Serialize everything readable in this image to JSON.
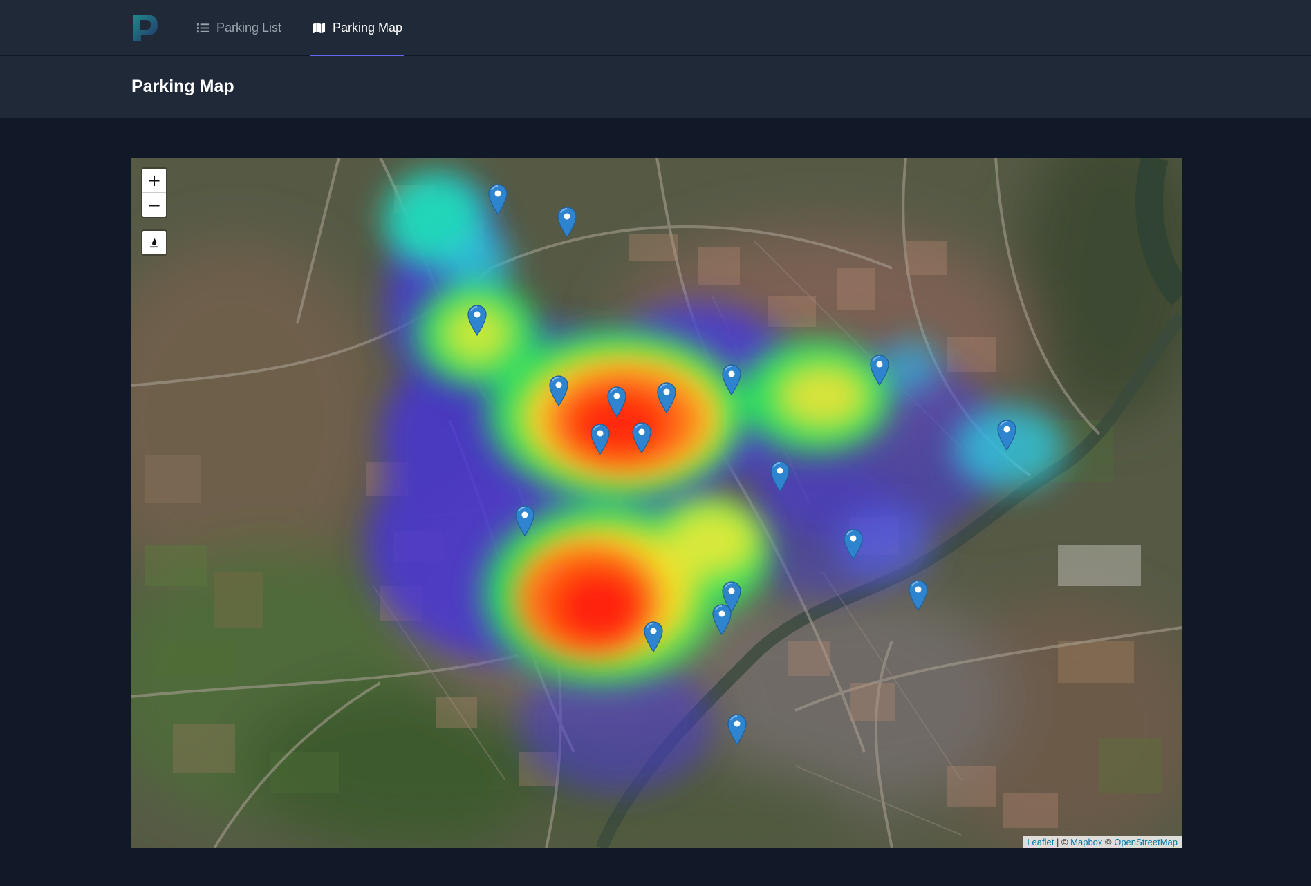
{
  "nav": {
    "items": [
      {
        "label": "Parking List",
        "icon": "list-icon",
        "active": false
      },
      {
        "label": "Parking Map",
        "icon": "map-icon",
        "active": true
      }
    ],
    "accent": "#6366f1"
  },
  "page": {
    "title": "Parking Map"
  },
  "map": {
    "zoom_in_label": "+",
    "zoom_out_label": "−",
    "heatmap_toggle_icon": "heatmap-icon",
    "marker_count": 19,
    "attribution": {
      "leaflet": "Leaflet",
      "sep1": " | © ",
      "mapbox": "Mapbox",
      "sep2": " © ",
      "osm": "OpenStreetMap"
    },
    "marker_color": "#2f84d0"
  }
}
